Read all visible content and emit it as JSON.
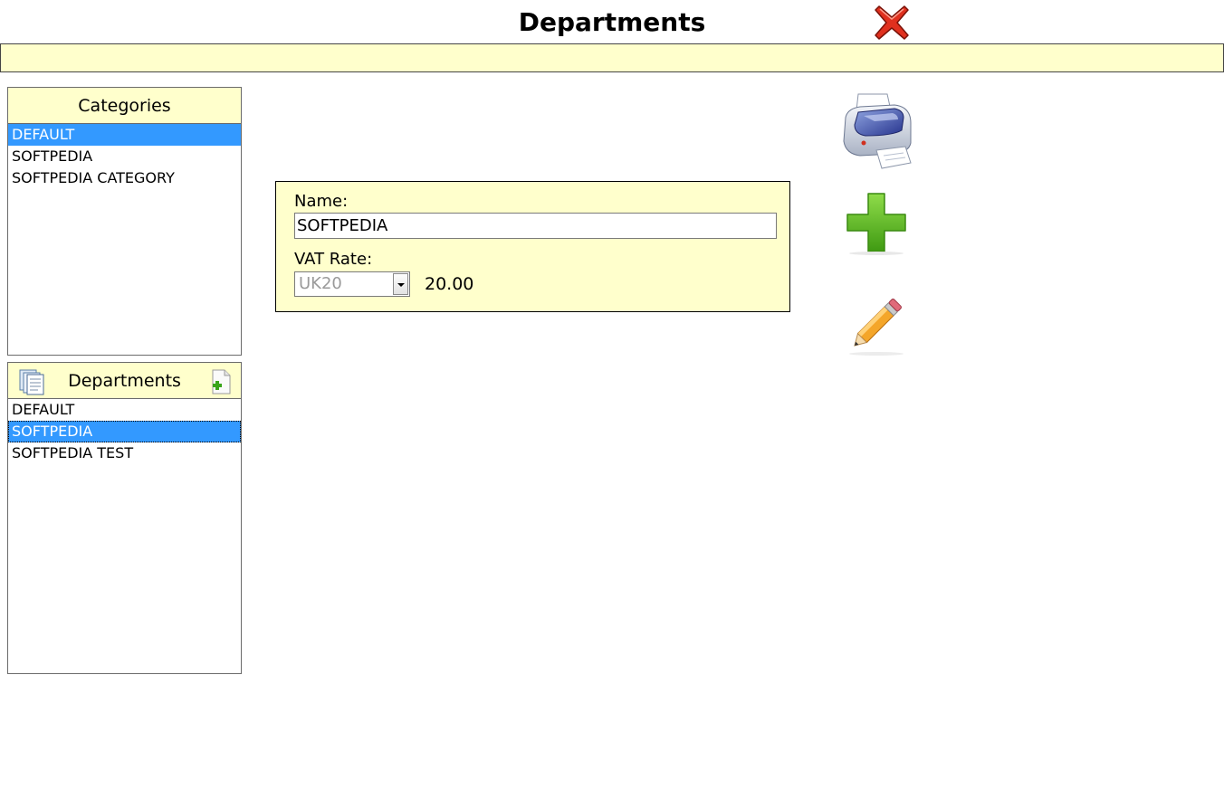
{
  "window": {
    "title": "Departments"
  },
  "categories": {
    "header": "Categories",
    "items": [
      {
        "label": "DEFAULT",
        "selected": true
      },
      {
        "label": "SOFTPEDIA",
        "selected": false
      },
      {
        "label": "SOFTPEDIA CATEGORY",
        "selected": false
      }
    ]
  },
  "departments": {
    "header": "Departments",
    "items": [
      {
        "label": "DEFAULT",
        "selected": false
      },
      {
        "label": "SOFTPEDIA",
        "selected": true
      },
      {
        "label": "SOFTPEDIA TEST",
        "selected": false
      }
    ]
  },
  "form": {
    "name_label": "Name:",
    "name_value": "SOFTPEDIA",
    "vat_label": "VAT Rate:",
    "vat_selected": "UK20",
    "vat_rate_value": "20.00"
  },
  "icons": {
    "close": "close-icon",
    "print": "printer-icon",
    "add": "plus-icon",
    "edit": "pencil-icon",
    "list": "document-list-icon",
    "add_department": "add-document-icon"
  },
  "colors": {
    "panel_header_bg": "#ffffcc",
    "selection": "#3399ff",
    "close_red": "#e0301e",
    "add_green": "#58b51c"
  }
}
